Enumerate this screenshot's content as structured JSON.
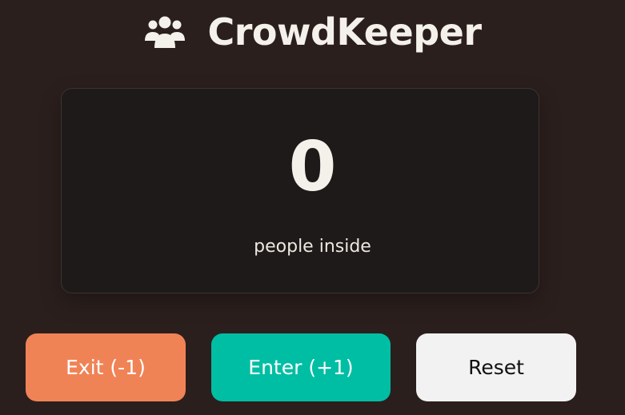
{
  "app": {
    "title": "CrowdKeeper",
    "icon": "users-icon"
  },
  "counter": {
    "value": "0",
    "caption": "people inside"
  },
  "buttons": {
    "exit_label": "Exit (-1)",
    "enter_label": "Enter (+1)",
    "reset_label": "Reset"
  },
  "colors": {
    "background": "#2b1f1d",
    "card": "#1e1a19",
    "text": "#f4f0ea",
    "exit": "#f08356",
    "enter": "#00bea4",
    "reset": "#f2f2f2"
  }
}
